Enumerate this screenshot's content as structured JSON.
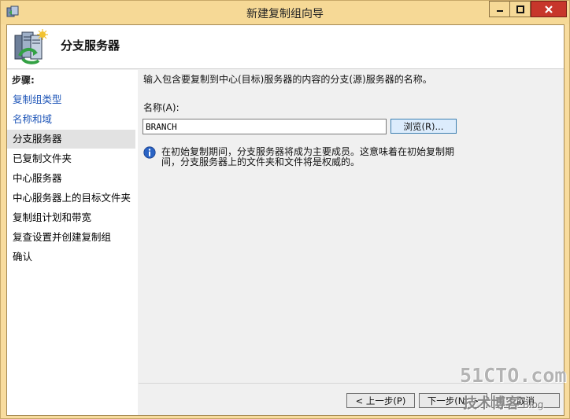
{
  "window": {
    "title": "新建复制组向导"
  },
  "titlebar_buttons": {
    "minimize": "–",
    "maximize": "□",
    "close": "✕"
  },
  "header": {
    "title": "分支服务器"
  },
  "steps": {
    "heading": "步骤:",
    "items": [
      {
        "label": "复制组类型"
      },
      {
        "label": "名称和域"
      },
      {
        "label": "分支服务器"
      },
      {
        "label": "已复制文件夹"
      },
      {
        "label": "中心服务器"
      },
      {
        "label": "中心服务器上的目标文件夹"
      },
      {
        "label": "复制组计划和带宽"
      },
      {
        "label": "复查设置并创建复制组"
      },
      {
        "label": "确认"
      }
    ]
  },
  "main": {
    "description": "输入包含要复制到中心(目标)服务器的内容的分支(源)服务器的名称。",
    "name_label": "名称(A):",
    "name_value": "BRANCH",
    "browse_label": "浏览(R)...",
    "info_text": "在初始复制期间，分支服务器将成为主要成员。这意味着在初始复制期间，分支服务器上的文件夹和文件将是权威的。"
  },
  "footer": {
    "prev_label": "< 上一步(P)",
    "next_label": "下一步(N) >",
    "cancel_label": "取消"
  },
  "watermark": {
    "site": "51CTO.com",
    "tagline": "技术博客",
    "blog": "Blog"
  },
  "colors": {
    "window_frame": "#f8dc9e",
    "link_step": "#1f56b8",
    "close_button": "#c7362b"
  }
}
